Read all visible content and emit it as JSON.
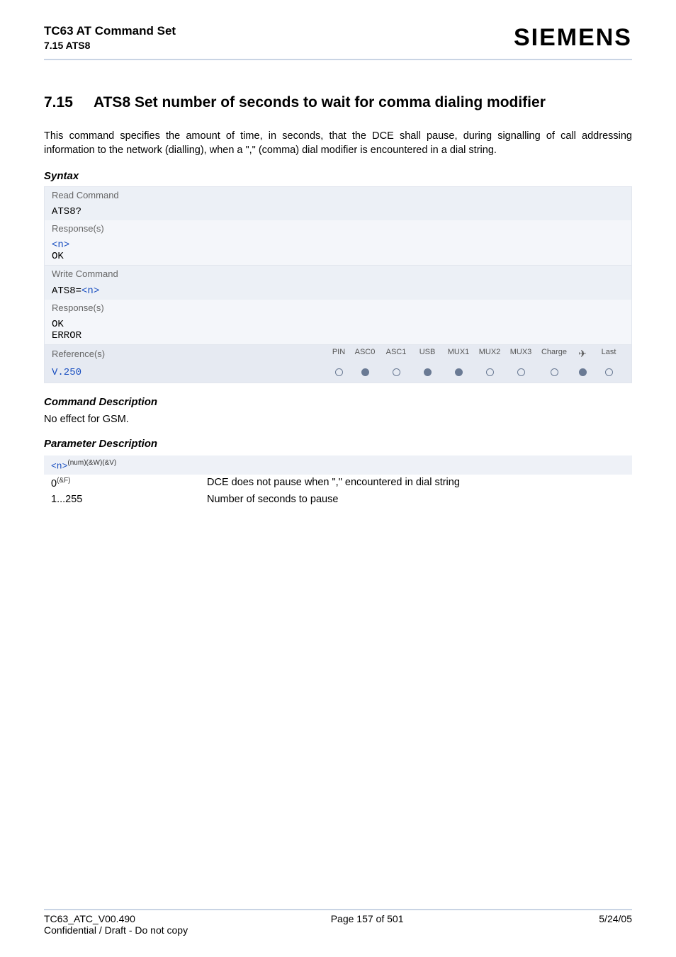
{
  "header": {
    "doc_title": "TC63 AT Command Set",
    "doc_sub": "7.15 ATS8",
    "brand": "SIEMENS"
  },
  "section": {
    "num": "7.15",
    "title": "ATS8   Set number of seconds to wait for comma dialing modifier"
  },
  "intro": "This command specifies the amount of time, in seconds, that the DCE shall pause, during signalling of call addressing information to the network (dialling), when a \",\" (comma) dial modifier is encountered in a dial string.",
  "labels": {
    "syntax": "Syntax",
    "read_command": "Read Command",
    "write_command": "Write Command",
    "responses": "Response(s)",
    "references": "Reference(s)",
    "command_description": "Command Description",
    "parameter_description": "Parameter Description"
  },
  "read": {
    "cmd": "ATS8?",
    "resp_n": "<n>",
    "resp_ok": "OK"
  },
  "write": {
    "cmd_prefix": "ATS8=",
    "cmd_param": "<n>",
    "resp_ok": "OK",
    "resp_err": "ERROR"
  },
  "ref": {
    "value": "V.250",
    "cols": [
      "PIN",
      "ASC0",
      "ASC1",
      "USB",
      "MUX1",
      "MUX2",
      "MUX3",
      "Charge",
      "✈",
      "Last"
    ],
    "dots": [
      "empty",
      "filled",
      "empty",
      "filled",
      "filled",
      "empty",
      "empty",
      "empty",
      "filled",
      "empty"
    ]
  },
  "cmd_desc": "No effect for GSM.",
  "param": {
    "name": "<n>",
    "sup": "(num)(&W)(&V)",
    "rows": [
      {
        "val": "0",
        "val_sup": "(&F)",
        "desc": "DCE does not pause when \",\" encountered in dial string"
      },
      {
        "val": "1...255",
        "val_sup": "",
        "desc": "Number of seconds to pause"
      }
    ]
  },
  "footer": {
    "left": "TC63_ATC_V00.490",
    "center": "Page 157 of 501",
    "right": "5/24/05",
    "sub": "Confidential / Draft - Do not copy"
  }
}
